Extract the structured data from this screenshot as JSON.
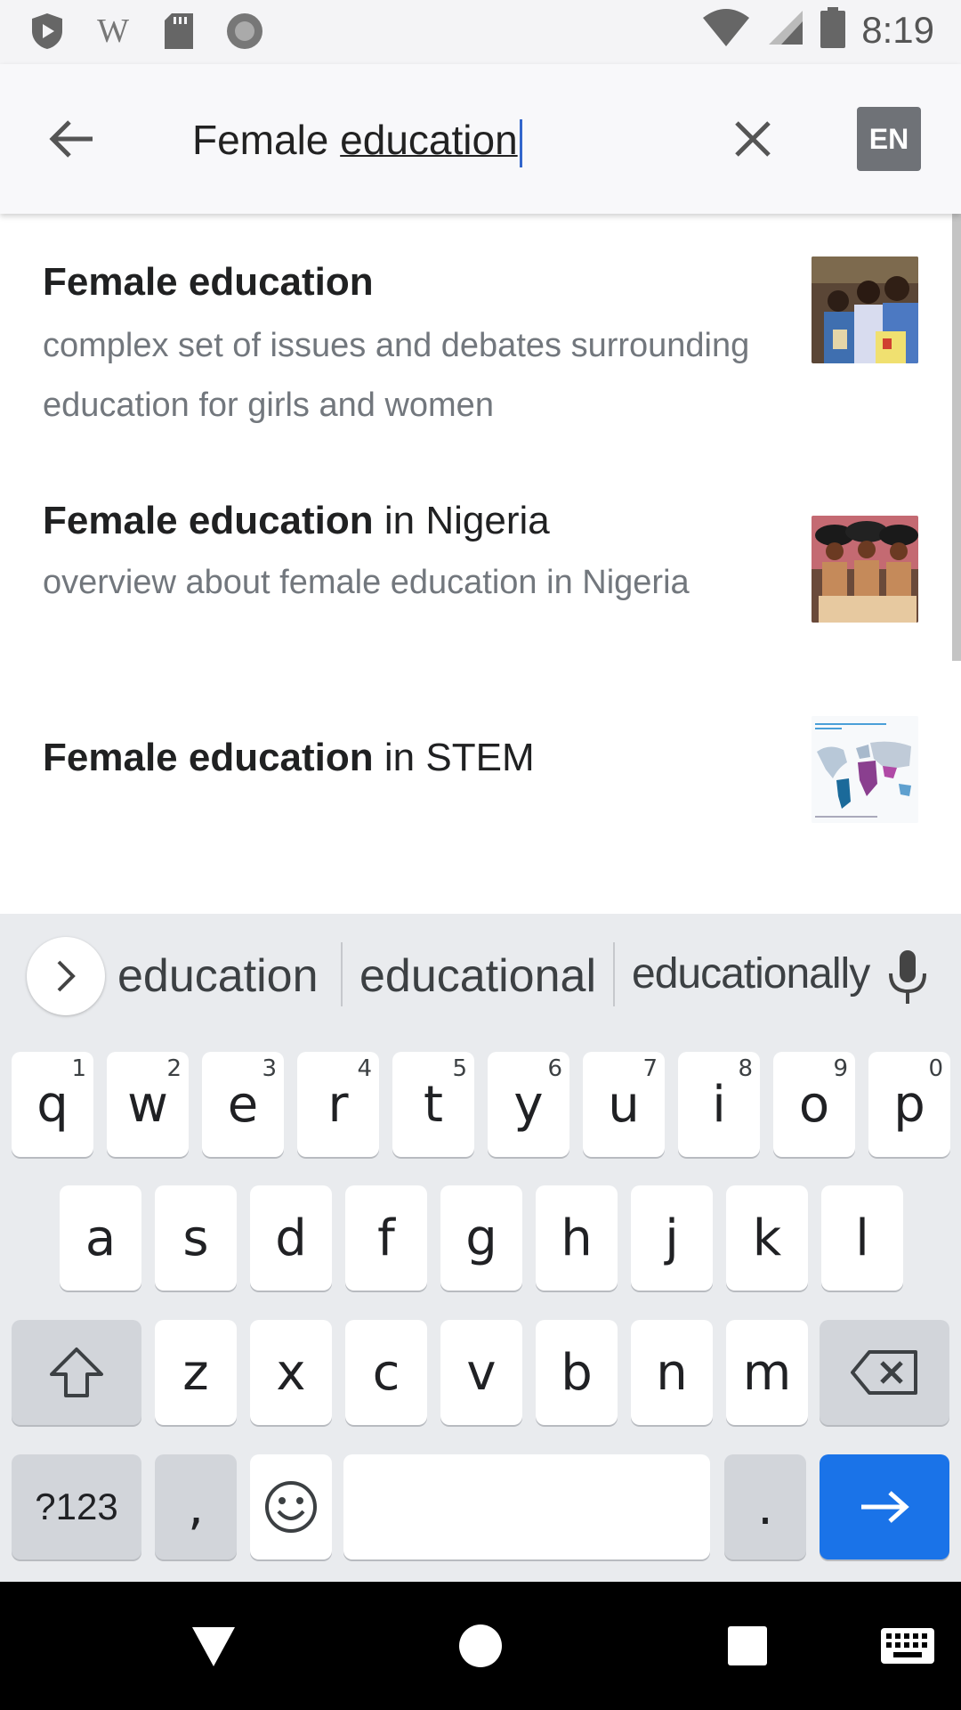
{
  "status_bar": {
    "time": "8:19",
    "left_icons": [
      "play-protect-icon",
      "wikipedia-icon",
      "sd-card-icon",
      "record-icon"
    ],
    "right_icons": [
      "wifi-icon",
      "signal-icon",
      "battery-icon"
    ]
  },
  "search": {
    "query_prefix": "Female ",
    "query_composing": "education",
    "language_button": "EN"
  },
  "results": [
    {
      "title_bold": "Female education",
      "title_rest": "",
      "description": "complex set of issues and debates surrounding education for girls and women"
    },
    {
      "title_bold": "Female education",
      "title_rest": " in Nigeria",
      "description": "overview about female education in Nigeria"
    },
    {
      "title_bold": "Female education",
      "title_rest": " in STEM",
      "description": ""
    }
  ],
  "keyboard": {
    "suggestions": [
      "education",
      "educational",
      "educationally"
    ],
    "row1": [
      "q",
      "w",
      "e",
      "r",
      "t",
      "y",
      "u",
      "i",
      "o",
      "p"
    ],
    "row1_hints": [
      "1",
      "2",
      "3",
      "4",
      "5",
      "6",
      "7",
      "8",
      "9",
      "0"
    ],
    "row2": [
      "a",
      "s",
      "d",
      "f",
      "g",
      "h",
      "j",
      "k",
      "l"
    ],
    "row3": [
      "z",
      "x",
      "c",
      "v",
      "b",
      "n",
      "m"
    ],
    "symbols_key": "?123",
    "comma_key": ",",
    "period_key": ".",
    "colors": {
      "enter": "#1a73e8",
      "key": "#ffffff",
      "function_key": "#d2d5da"
    }
  },
  "nav_bar": {
    "icons": [
      "back-triangle-icon",
      "home-circle-icon",
      "recents-square-icon",
      "keyboard-switch-icon"
    ]
  }
}
